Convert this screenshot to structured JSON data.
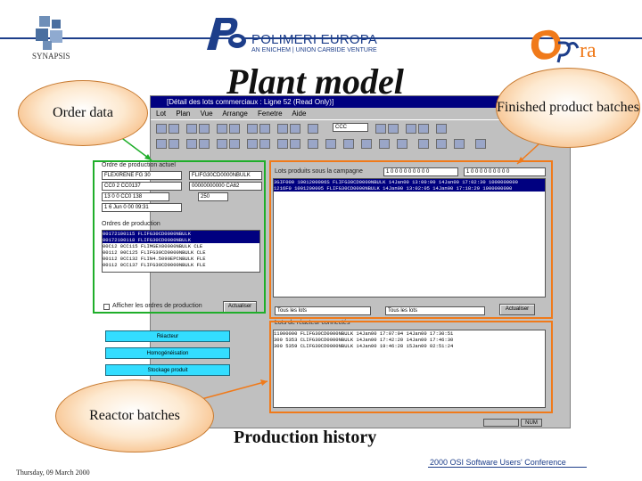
{
  "header": {
    "synapsis_label": "SYNAPSIS",
    "pe_company": "POLIMERI EUROPA",
    "pe_subtitle": "AN ENICHEM | UNION CARBIDE VENTURE",
    "slide_title": "Plant model",
    "opera_logo_text": "ra"
  },
  "callouts": {
    "order_data": "Order data",
    "finished_product": "Finished product batches",
    "reactor_batches": "Reactor batches",
    "production_history": "Production history"
  },
  "footer": {
    "date": "Thursday, 09 March 2000",
    "conference": "2000 OSI Software Users' Conference"
  },
  "app": {
    "title": "[Détail des lots commerciaux : Ligne 52 (Read Only)]",
    "menu": [
      "Lot",
      "Plan",
      "Vue",
      "Arrange",
      "Fenetre",
      "Aide"
    ],
    "toolbar_combo": "CCC",
    "order_section": {
      "title": "Ordre de production actuel",
      "fields": [
        "FLEXIRENE FG 30",
        "FLIFG30CD0000NBULK",
        "CC0 2 CC0137",
        "00000000000 CA62",
        "13 0 0 CC0 138",
        "250",
        "1 6 Jun 0 00 09:31"
      ],
      "list_title": "Ordres de production",
      "rows": [
        "00172100115   FLIFG30CD0000NBULK",
        "00172100118   FLIFG30CD0000NBULK",
        "00C12 0CC115  FLIMGEX00000NBULK  CLE",
        "00112 00C125  FLIFG30CD0000NBULK  CLE",
        "00112 0CC132  FLIN4.5090EPCNBULK  FLE",
        "00112 0CC137  FLIFG30CD0000NBULK  FLE"
      ],
      "checkbox_label": "Afficher les ordres de production",
      "button": "Actualiser"
    },
    "batches_section": {
      "title": "Lots produits sous la campagne",
      "combo1": "1 0 0 0 0 0 0 0 0 0",
      "combo2": "1 0 0 0 0 0 0 0 0 0",
      "rows": [
        "3GIF000  1001200006S  FLIFG30CD0000NBULK  14Jan00 13:00:00  14Jan00 17:02:30  1000000000",
        "1216F0   1001200005   FLIFG30CD0000NBULK  14Jan00 13:02:05  14Jan00 17:18:29  1000000000"
      ],
      "combo_left": "Tous les lots",
      "combo_right": "Tous les lots",
      "button": "Actualiser"
    },
    "reactor_section": {
      "title": "Lots de réacteur connectés",
      "rows": [
        "11000000  FLIFG30CD0000NBULK  14Jan00 17:07:04  14Jan00 17:30:51",
        "300 5353  CLIFG30CD0000NBULK  14Jan00 17:42:20  14Jan00 17:46:30",
        "300 5359  CLIFG30CD0000NBULK  14Jan00 19:46:28  15Jan00 02:51:24"
      ]
    },
    "side_buttons": [
      "Réacteur",
      "Homogénéisation",
      "Stockage produit"
    ],
    "status": "NUM"
  },
  "colors": {
    "brand_blue": "#1d3e8a",
    "highlight_green": "#1fae2a",
    "highlight_orange": "#f07a1a",
    "button_cyan": "#33ddff"
  }
}
